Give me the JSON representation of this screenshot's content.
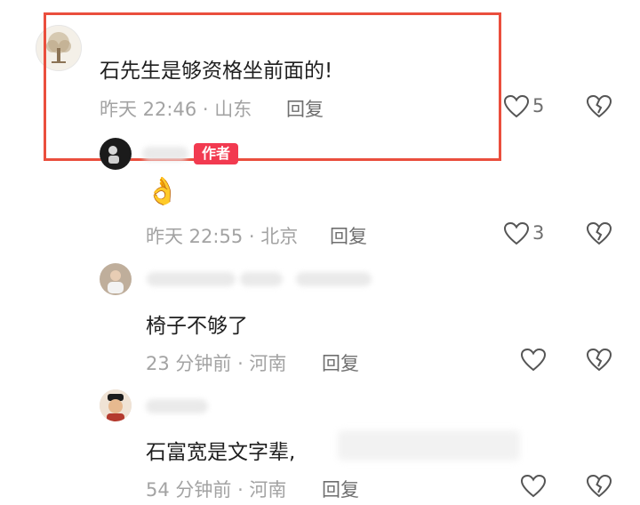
{
  "comments": [
    {
      "text": "石先生是够资格坐前面的!",
      "meta": "昨天 22:46 · 山东",
      "reply": "回复",
      "likes": "5"
    },
    {
      "badge": "作者",
      "text": "👌",
      "meta": "昨天 22:55 · 北京",
      "reply": "回复",
      "likes": "3"
    },
    {
      "text": "椅子不够了",
      "meta": "23 分钟前 · 河南",
      "reply": "回复",
      "likes": ""
    },
    {
      "text": "石富宽是文字辈,",
      "meta": "54 分钟前 · 河南",
      "reply": "回复",
      "likes": ""
    }
  ],
  "icons": {
    "like": "heart-outline-icon",
    "dislike": "broken-heart-icon"
  },
  "colors": {
    "highlight": "#ea4e3d",
    "author_badge": "#f23a50",
    "meta_text": "#a3a3a3"
  }
}
